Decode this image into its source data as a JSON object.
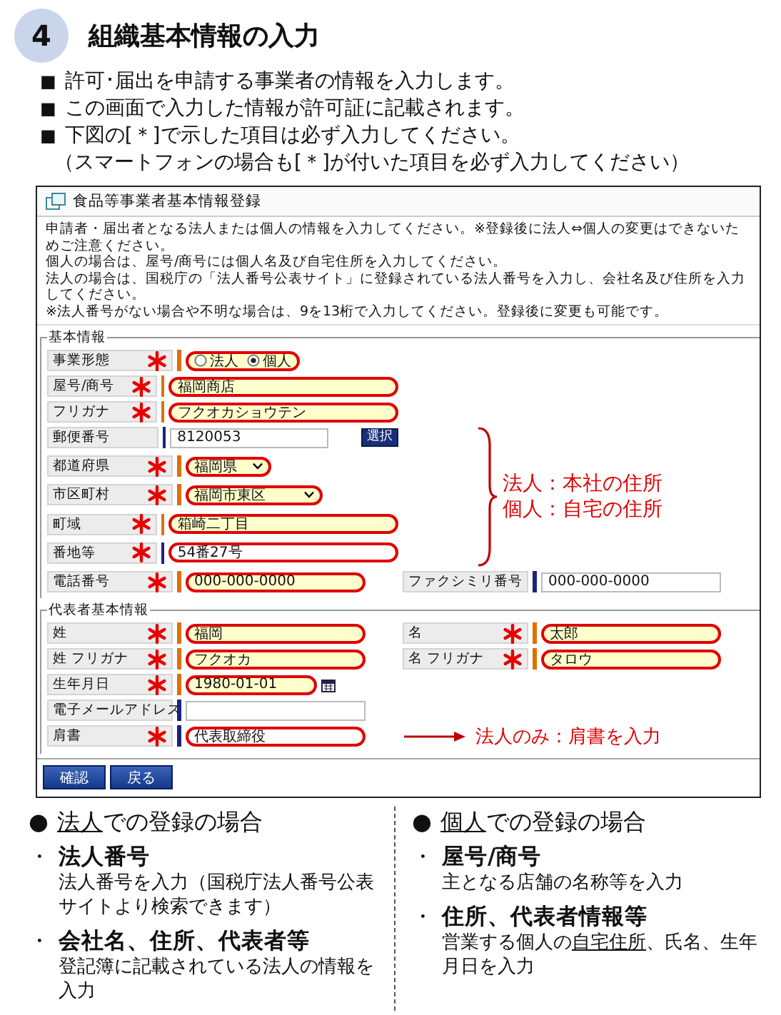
{
  "step": {
    "number": "4",
    "title": "組織基本情報の入力"
  },
  "bullets": [
    {
      "marker": "■",
      "text": "許可･届出を申請する事業者の情報を入力します。"
    },
    {
      "marker": "■",
      "text": "この画面で入力した情報が許可証に記載されます。"
    },
    {
      "marker": "■",
      "text": "下図の[＊]で示した項目は必ず入力してください。"
    }
  ],
  "note": "（スマートフォンの場合も[＊]が付いた項目を必ず入力してください）",
  "form": {
    "title": "食品等事業者基本情報登録",
    "instructions": [
      "申請者・届出者となる法人または個人の情報を入力してください。※登録後に法人⇔個人の変更はできないためご注意ください。",
      "個人の場合は、屋号/商号には個人名及び自宅住所を入力してください。",
      "法人の場合は、国税庁の「法人番号公表サイト」に登録されている法人番号を入力し、会社名及び住所を入力してください。",
      "※法人番号がない場合や不明な場合は、9を13桁で入力してください。登録後に変更も可能です。"
    ],
    "sections": [
      {
        "legend": "基本情報",
        "annotation": [
          "法人：本社の住所",
          "個人：自宅の住所"
        ],
        "rows": [
          {
            "kind": "radio",
            "label": "事業形態",
            "required": true,
            "starred": true,
            "options": [
              {
                "label": "法人",
                "selected": false
              },
              {
                "label": "個人",
                "selected": true
              }
            ]
          },
          {
            "kind": "text",
            "label": "屋号/商号",
            "value": "福岡商店",
            "required": true,
            "starred": true
          },
          {
            "kind": "text",
            "label": "フリガナ",
            "value": "フクオカショウテン",
            "required": true,
            "starred": true
          },
          {
            "kind": "postal",
            "label": "郵便番号",
            "value": "8120053",
            "button": "選択",
            "required": false,
            "starred": false
          },
          {
            "kind": "select",
            "label": "都道府県",
            "value": "福岡県",
            "required": true,
            "starred": true
          },
          {
            "kind": "select",
            "label": "市区町村",
            "value": "福岡市東区",
            "required": true,
            "starred": true
          },
          {
            "kind": "text",
            "label": "町域",
            "value": "箱崎二丁目",
            "required": true,
            "starred": true
          },
          {
            "kind": "text",
            "label": "番地等",
            "value": "54番27号",
            "required": false,
            "starred": true
          },
          {
            "kind": "pair",
            "label": "電話番号",
            "value": "000-000-0000",
            "required": true,
            "starred": true,
            "second": {
              "label": "ファクシミリ番号",
              "value": "000-000-0000",
              "required": false,
              "starred": false
            }
          }
        ]
      },
      {
        "legend": "代表者基本情報",
        "rows": [
          {
            "kind": "pair",
            "label": "姓",
            "value": "福岡",
            "required": true,
            "starred": true,
            "second": {
              "label": "名",
              "value": "太郎",
              "required": true,
              "starred": true
            }
          },
          {
            "kind": "pair",
            "label": "姓 フリガナ",
            "value": "フクオカ",
            "required": true,
            "starred": true,
            "second": {
              "label": "名 フリガナ",
              "value": "タロウ",
              "required": true,
              "starred": true
            }
          },
          {
            "kind": "date",
            "label": "生年月日",
            "value": "1980-01-01",
            "required": true,
            "starred": true
          },
          {
            "kind": "text",
            "label": "電子メールアドレス",
            "required": false,
            "starred": false
          },
          {
            "kind": "text",
            "label": "肩書",
            "value": "代表取締役",
            "required": false,
            "starred": true,
            "note": "法人のみ：肩書を入力"
          }
        ]
      }
    ],
    "buttons": [
      "確認",
      "戻る"
    ]
  },
  "cases": [
    {
      "marker": "●",
      "heading": [
        {
          "text": "法人",
          "underline": true
        },
        {
          "text": "での登録の場合",
          "underline": false
        }
      ],
      "items": [
        {
          "marker": "・",
          "title": "法人番号",
          "text": [
            {
              "text": "法人番号を入力（国税庁法人番号公表サイトより検索できます）",
              "underline": false
            }
          ]
        },
        {
          "marker": "・",
          "title": "会社名、住所、代表者等",
          "text": [
            {
              "text": "登記簿に記載されている法人の情報を入力",
              "underline": false
            }
          ]
        }
      ]
    },
    {
      "marker": "●",
      "heading": [
        {
          "text": "個人",
          "underline": true
        },
        {
          "text": "での登録の場合",
          "underline": false
        }
      ],
      "items": [
        {
          "marker": "・",
          "title": "屋号/商号",
          "text": [
            {
              "text": "主となる店舗の名称等を入力",
              "underline": false
            }
          ]
        },
        {
          "marker": "・",
          "title": "住所、代表者情報等",
          "text": [
            {
              "text": "営業する個人の",
              "underline": false
            },
            {
              "text": "自宅住所",
              "underline": true
            },
            {
              "text": "、氏名、生年月日を入力",
              "underline": false
            }
          ]
        }
      ]
    }
  ]
}
